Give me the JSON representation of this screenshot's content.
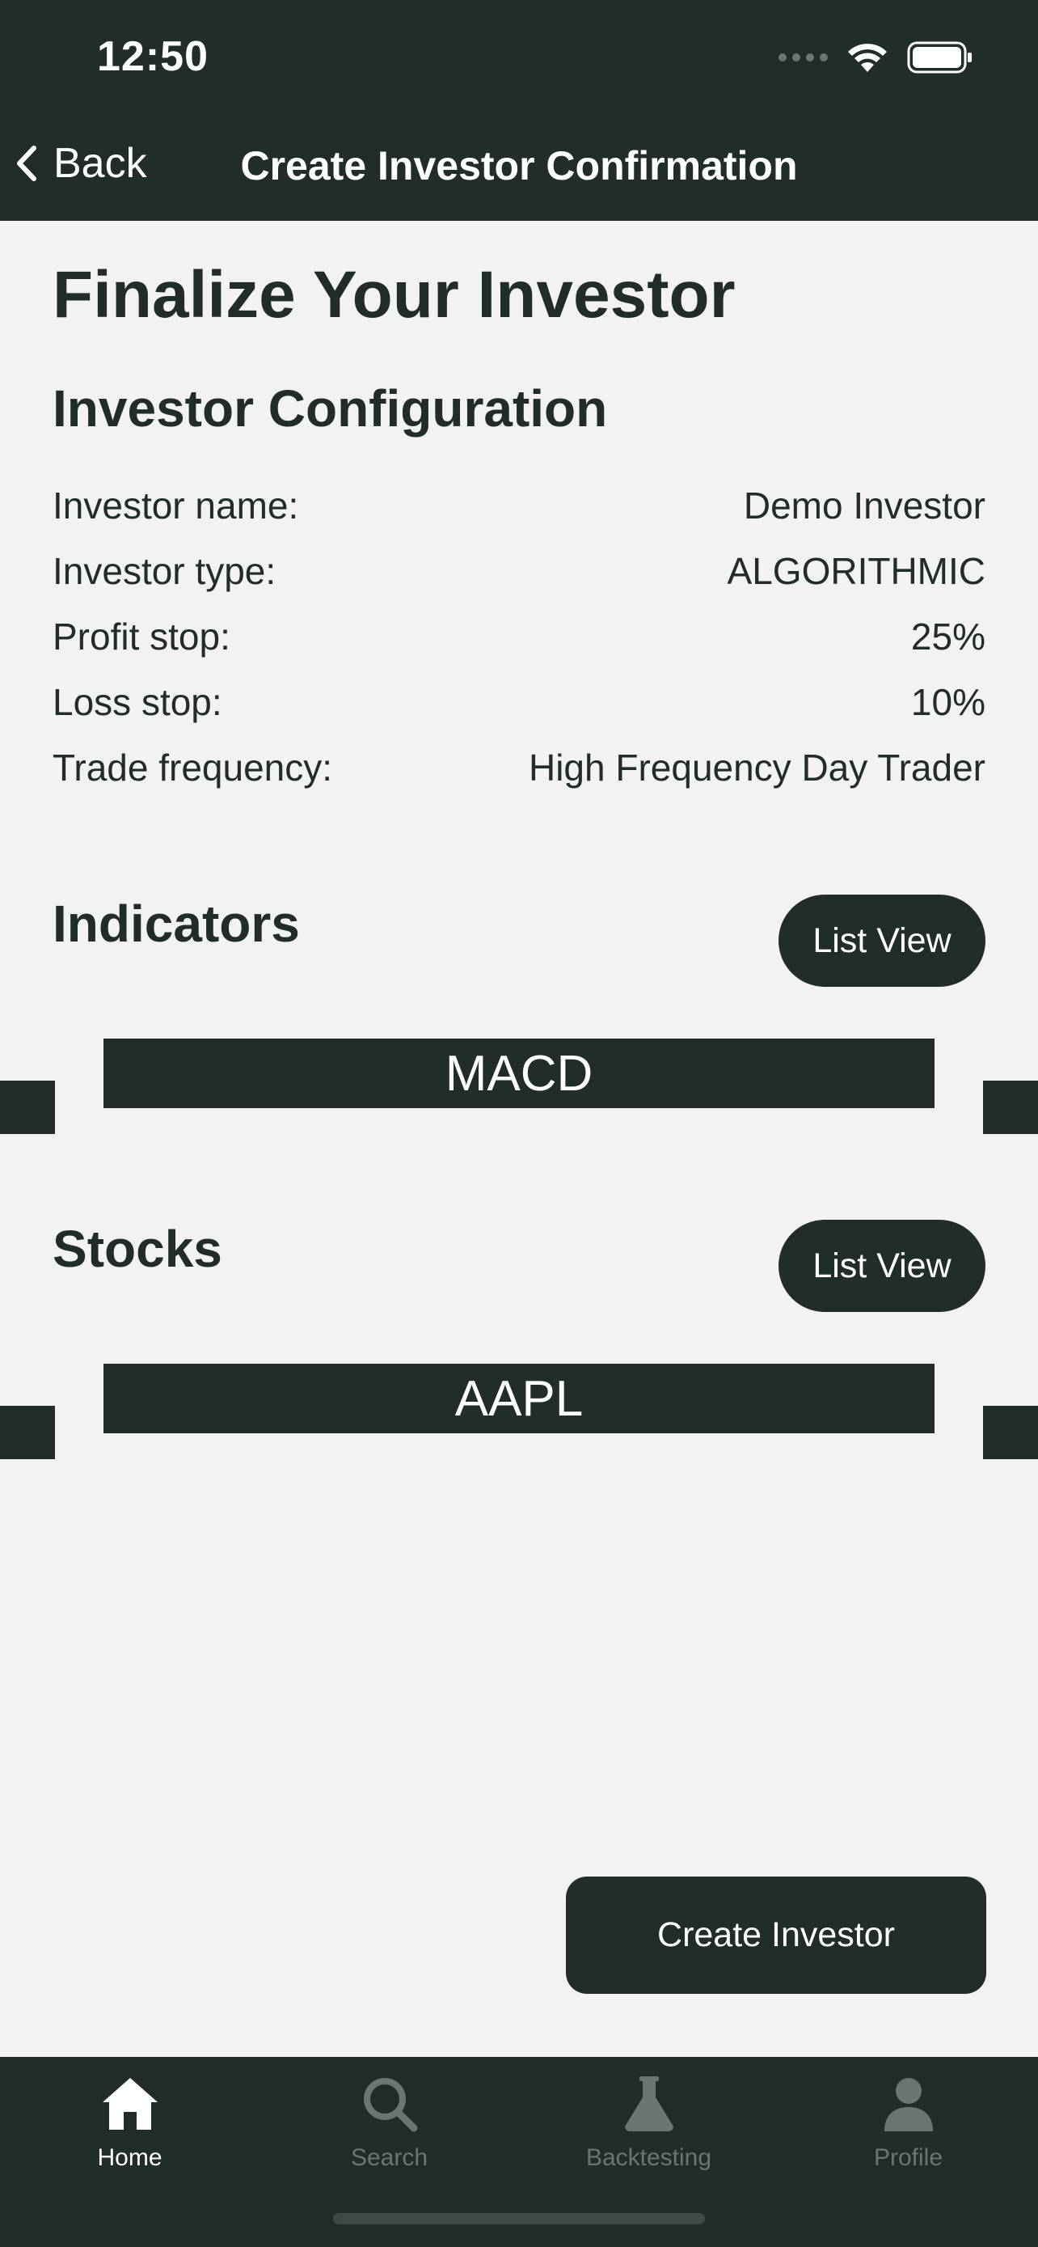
{
  "status_bar": {
    "time": "12:50"
  },
  "nav": {
    "back_label": "Back",
    "title": "Create Investor Confirmation"
  },
  "page": {
    "title": "Finalize Your Investor"
  },
  "config": {
    "title": "Investor Configuration",
    "rows": [
      {
        "label": "Investor name:",
        "value": "Demo Investor"
      },
      {
        "label": "Investor type:",
        "value": "ALGORITHMIC"
      },
      {
        "label": "Profit stop:",
        "value": "25%"
      },
      {
        "label": "Loss stop:",
        "value": "10%"
      },
      {
        "label": "Trade frequency:",
        "value": "High Frequency Day Trader"
      }
    ]
  },
  "indicators": {
    "title": "Indicators",
    "list_view_label": "List View",
    "items": [
      "MACD"
    ]
  },
  "stocks": {
    "title": "Stocks",
    "list_view_label": "List View",
    "items": [
      "AAPL"
    ]
  },
  "actions": {
    "create_label": "Create Investor"
  },
  "tabbar": {
    "tabs": [
      {
        "label": "Home",
        "icon": "home-icon",
        "active": true
      },
      {
        "label": "Search",
        "icon": "search-icon",
        "active": false
      },
      {
        "label": "Backtesting",
        "icon": "flask-icon",
        "active": false
      },
      {
        "label": "Profile",
        "icon": "person-icon",
        "active": false
      }
    ]
  },
  "colors": {
    "primary": "#212d29",
    "background": "#f2f2f2",
    "inactive": "#6b7572",
    "on_primary": "#ffffff"
  }
}
